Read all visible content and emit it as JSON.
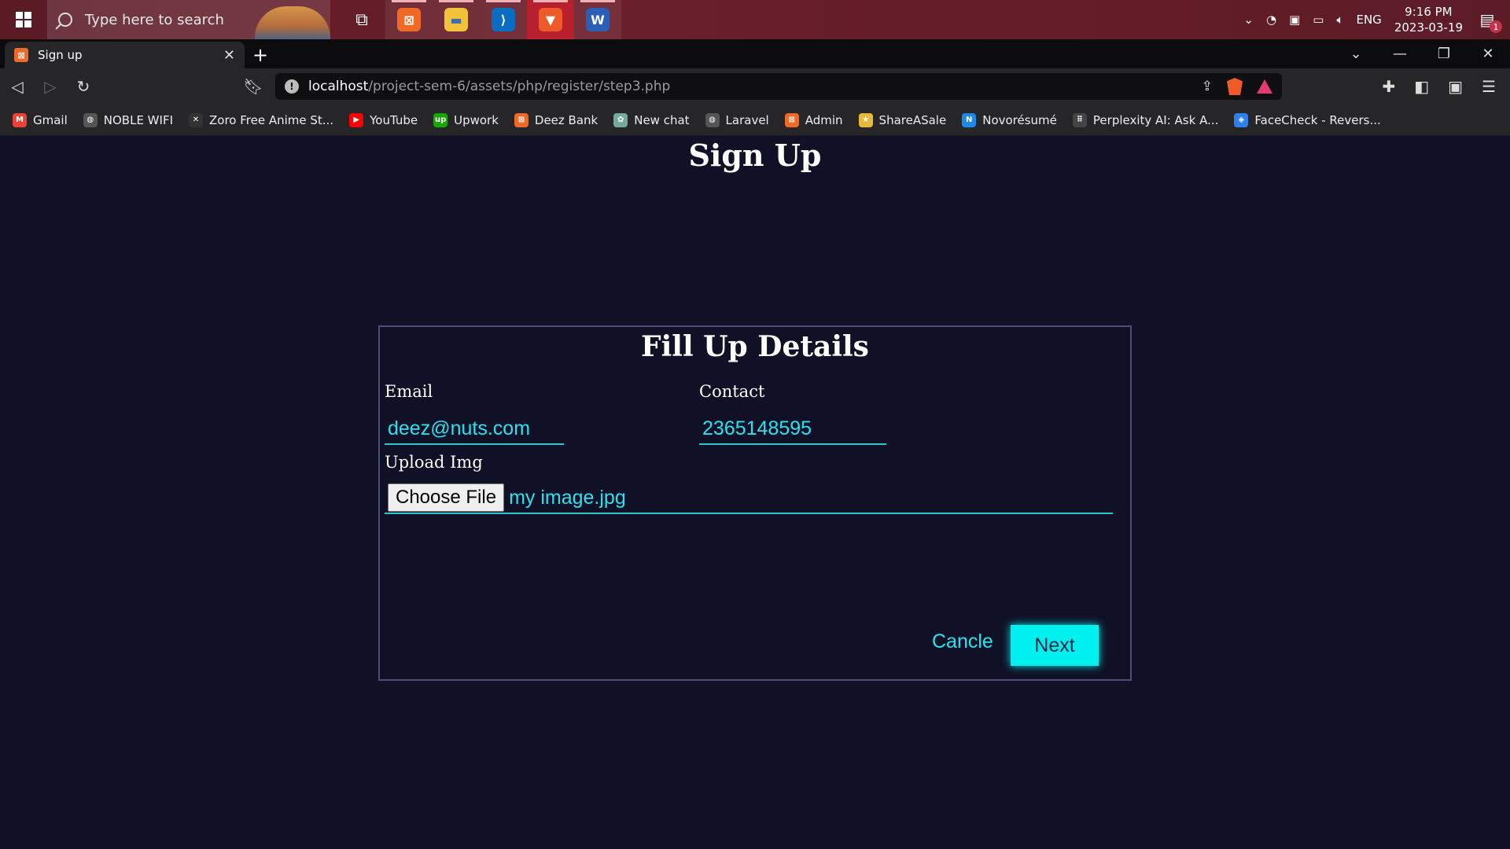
{
  "taskbar": {
    "search_placeholder": "Type here to search",
    "language": "ENG",
    "time": "9:16 PM",
    "date": "2023-03-19",
    "notification_count": "1"
  },
  "browser": {
    "tab_title": "Sign up",
    "url_host": "localhost",
    "url_path": "/project-sem-6/assets/php/register/step3.php"
  },
  "bookmarks": [
    {
      "label": "Gmail",
      "icon": "gmail-icon",
      "color": "#ea4335",
      "glyph": "M"
    },
    {
      "label": "NOBLE WIFI",
      "icon": "globe-icon",
      "color": "#555",
      "glyph": "◍"
    },
    {
      "label": "Zoro Free Anime St...",
      "icon": "zoro-icon",
      "color": "#333",
      "glyph": "✕"
    },
    {
      "label": "YouTube",
      "icon": "youtube-icon",
      "color": "#ff0000",
      "glyph": "▶"
    },
    {
      "label": "Upwork",
      "icon": "upwork-icon",
      "color": "#14a800",
      "glyph": "up"
    },
    {
      "label": "Deez Bank",
      "icon": "xampp-icon",
      "color": "#f06a27",
      "glyph": "⊠"
    },
    {
      "label": "New chat",
      "icon": "chatgpt-icon",
      "color": "#74aa9c",
      "glyph": "✿"
    },
    {
      "label": "Laravel",
      "icon": "globe-icon",
      "color": "#555",
      "glyph": "◍"
    },
    {
      "label": "Admin",
      "icon": "xampp-icon",
      "color": "#f06a27",
      "glyph": "⊠"
    },
    {
      "label": "ShareASale",
      "icon": "star-icon",
      "color": "#e8b93a",
      "glyph": "★"
    },
    {
      "label": "Novorésumé",
      "icon": "novoresume-icon",
      "color": "#1e88e5",
      "glyph": "N"
    },
    {
      "label": "Perplexity AI: Ask A...",
      "icon": "grid-icon",
      "color": "#444",
      "glyph": "⠿"
    },
    {
      "label": "FaceCheck - Revers...",
      "icon": "shield-icon",
      "color": "#2f80ed",
      "glyph": "◈"
    }
  ],
  "page": {
    "title": "Sign Up",
    "form_title": "Fill Up Details",
    "email_label": "Email",
    "email_value": "deez@nuts.com",
    "contact_label": "Contact",
    "contact_value": "2365148595",
    "upload_label": "Upload Img",
    "choose_file_label": "Choose File",
    "file_name": "my image.jpg",
    "cancel_label": "Cancle",
    "next_label": "Next"
  },
  "colors": {
    "page_bg": "#101026",
    "accent": "#27e3ef",
    "next_button": "#00f0f0"
  }
}
